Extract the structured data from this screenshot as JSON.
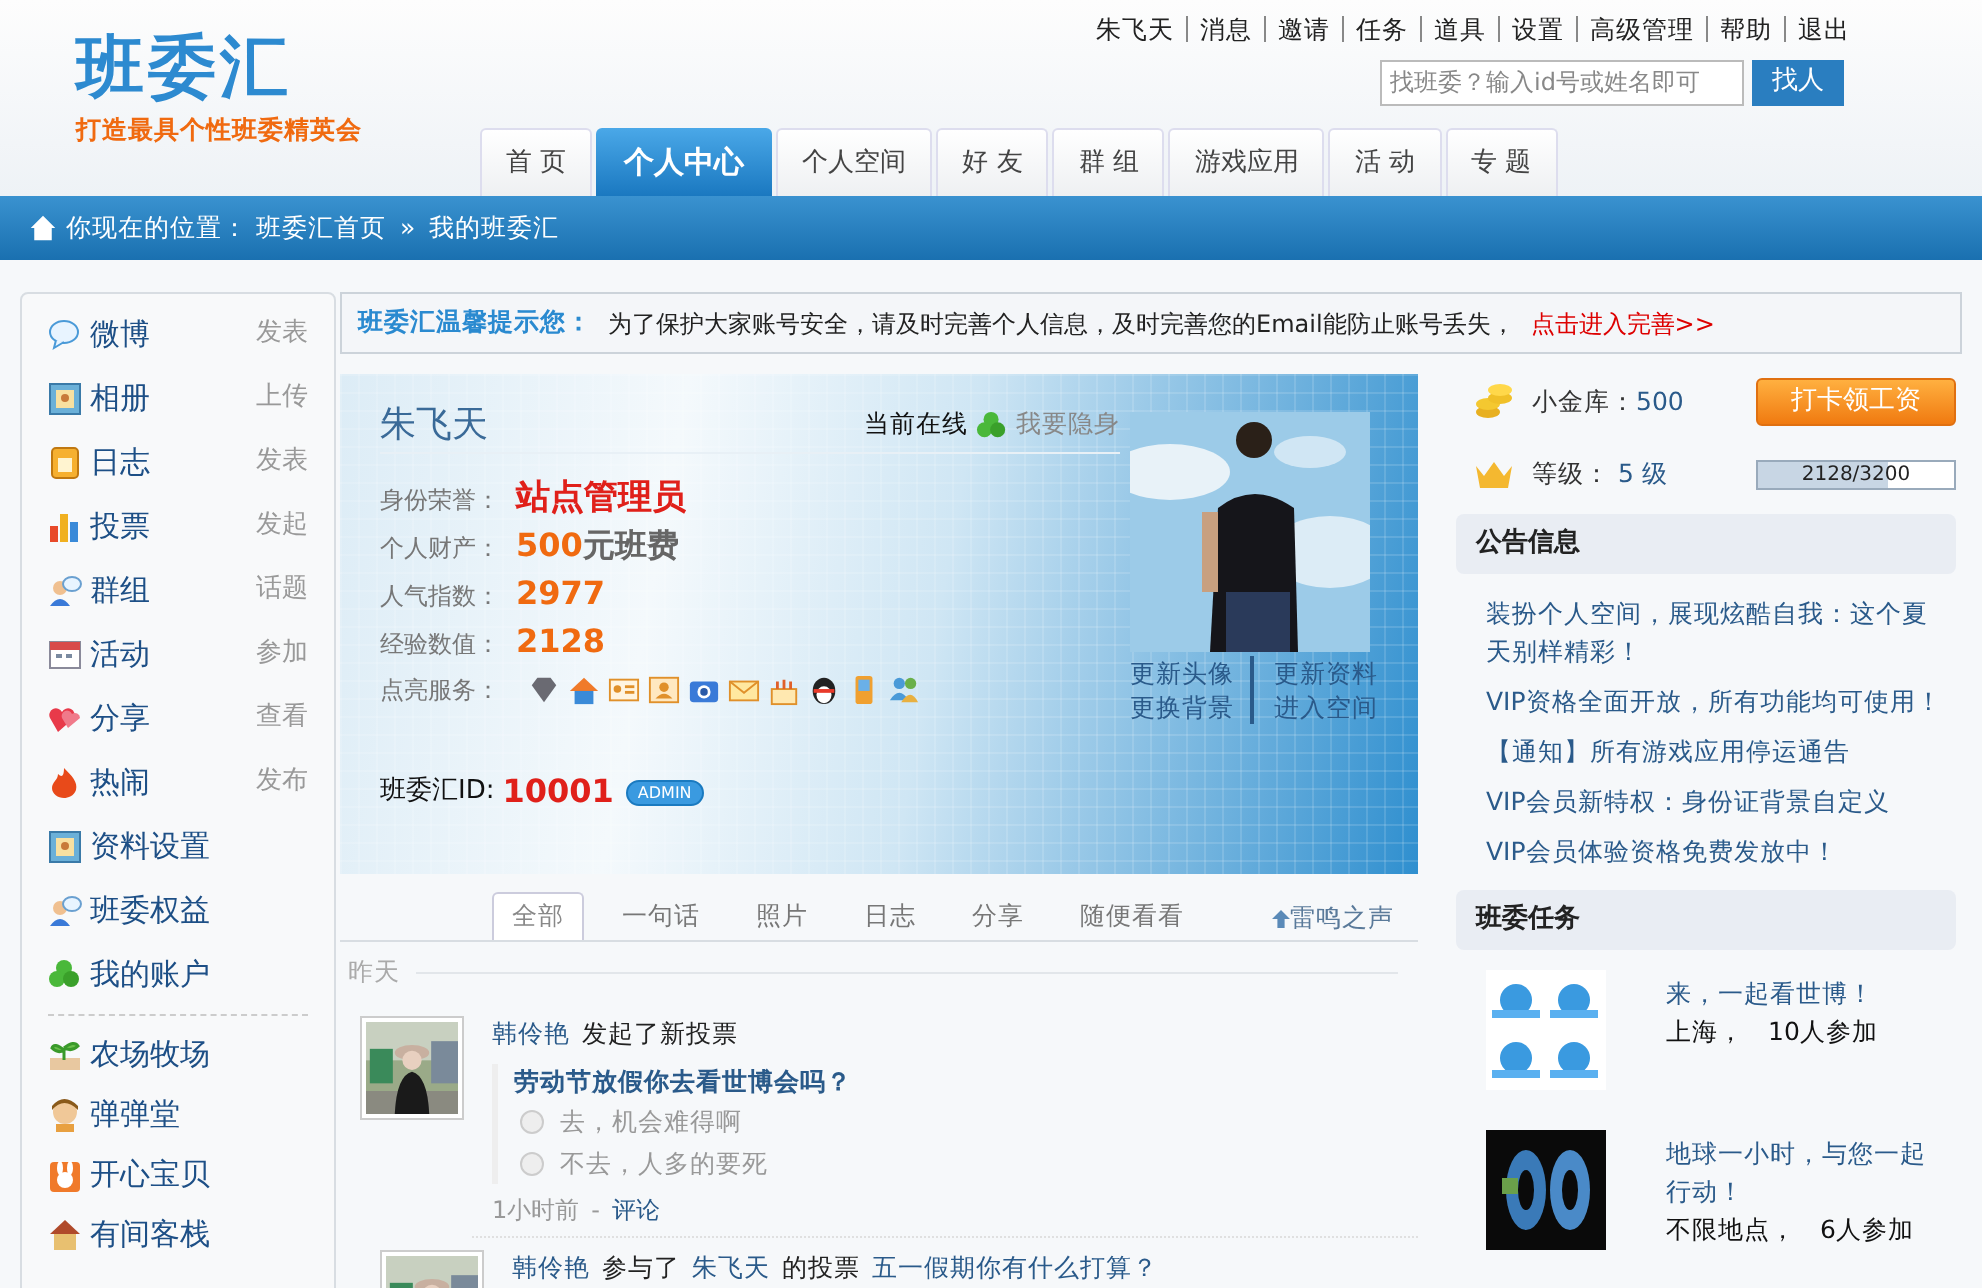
{
  "header": {
    "logo": "班委汇",
    "slogan": "打造最具个性班委精英会",
    "top_links": [
      "朱飞天",
      "消息",
      "邀请",
      "任务",
      "道具",
      "设置",
      "高级管理",
      "帮助",
      "退出"
    ],
    "search": {
      "placeholder": "找班委？输入id号或姓名即可",
      "button": "找人"
    },
    "nav_tabs": [
      {
        "label": "首 页",
        "selected": false
      },
      {
        "label": "个人中心",
        "selected": true
      },
      {
        "label": "个人空间",
        "selected": false
      },
      {
        "label": "好 友",
        "selected": false
      },
      {
        "label": "群 组",
        "selected": false
      },
      {
        "label": "游戏应用",
        "selected": false
      },
      {
        "label": "活 动",
        "selected": false
      },
      {
        "label": "专 题",
        "selected": false
      }
    ]
  },
  "breadcrumb": {
    "label": "你现在的位置：",
    "separator": "»",
    "items": [
      "班委汇首页",
      "我的班委汇"
    ]
  },
  "sidebar": {
    "groups": [
      {
        "items": [
          {
            "label": "微博",
            "action": "发表"
          },
          {
            "label": "相册",
            "action": "上传"
          },
          {
            "label": "日志",
            "action": "发表"
          },
          {
            "label": "投票",
            "action": "发起"
          },
          {
            "label": "群组",
            "action": "话题"
          },
          {
            "label": "活动",
            "action": "参加"
          },
          {
            "label": "分享",
            "action": "查看"
          },
          {
            "label": "热闹",
            "action": "发布"
          },
          {
            "label": "资料设置"
          },
          {
            "label": "班委权益"
          },
          {
            "label": "我的账户"
          }
        ]
      },
      {
        "items": [
          {
            "label": "农场牧场"
          },
          {
            "label": "弹弹堂"
          },
          {
            "label": "开心宝贝"
          },
          {
            "label": "有间客栈"
          }
        ]
      }
    ]
  },
  "notice": {
    "title": "班委汇温馨提示您：",
    "text": "为了保护大家账号安全，请及时完善个人信息，及时完善您的Email能防止账号丢失，",
    "link": "点击进入完善>>"
  },
  "profile": {
    "name": "朱飞天",
    "status": "当前在线",
    "hide_link": "我要隐身",
    "fields": [
      {
        "label": "身份荣誉：",
        "value": "站点管理员",
        "kind": "title"
      },
      {
        "label": "个人财产：",
        "value": "500",
        "unit": "元班费",
        "kind": "number"
      },
      {
        "label": "人气指数：",
        "value": "2977",
        "kind": "number"
      },
      {
        "label": "经验数值：",
        "value": "2128",
        "kind": "number"
      }
    ],
    "services_label": "点亮服务：",
    "id_label": "班委汇ID:",
    "id": "10001",
    "badge": "ADMIN",
    "photo_links": [
      "更新头像",
      "更新资料",
      "更换背景",
      "进入空间"
    ]
  },
  "feed": {
    "tabs": [
      {
        "label": "全部",
        "selected": true
      },
      {
        "label": "一句话",
        "selected": false
      },
      {
        "label": "照片",
        "selected": false
      },
      {
        "label": "日志",
        "selected": false
      },
      {
        "label": "分享",
        "selected": false
      },
      {
        "label": "随便看看",
        "selected": false
      }
    ],
    "side_link": "雷鸣之声",
    "day": "昨天",
    "items": [
      {
        "kind": "vote",
        "user": "韩伶艳",
        "action": "发起了新投票",
        "title": "劳动节放假你去看世博会吗？",
        "options": [
          {
            "label": "去，机会难得啊",
            "selected": false
          },
          {
            "label": "不去，人多的要死",
            "selected": false
          }
        ],
        "time": "1小时前",
        "comment_separator": "-",
        "comment": "评论"
      },
      {
        "kind": "join",
        "user": "韩伶艳",
        "action": "参与了",
        "target": "朱飞天",
        "action2": "的投票",
        "title": "五一假期你有什么打算？"
      }
    ]
  },
  "account": {
    "coins_label": "小金库：",
    "coins": "500",
    "checkin_button": "打卡领工资",
    "level_label": "等级：",
    "level_value": "5 级",
    "progress": "2128/3200",
    "level": 0.665
  },
  "announcements": {
    "title": "公告信息",
    "items": [
      "装扮个人空间，展现炫酷自我：这个夏天别样精彩！",
      "VIP资格全面开放，所有功能均可使用！",
      "【通知】所有游戏应用停运通告",
      "VIP会员新特权：身份证背景自定义",
      "VIP会员体验资格免费发放中！"
    ]
  },
  "tasks": {
    "title": "班委任务",
    "items": [
      {
        "title": "来，一起看世博！",
        "place": "上海，",
        "count": "10人参加"
      },
      {
        "title": "地球一小时，与您一起行动！",
        "place": "不限地点，",
        "count": "6人参加"
      }
    ]
  }
}
